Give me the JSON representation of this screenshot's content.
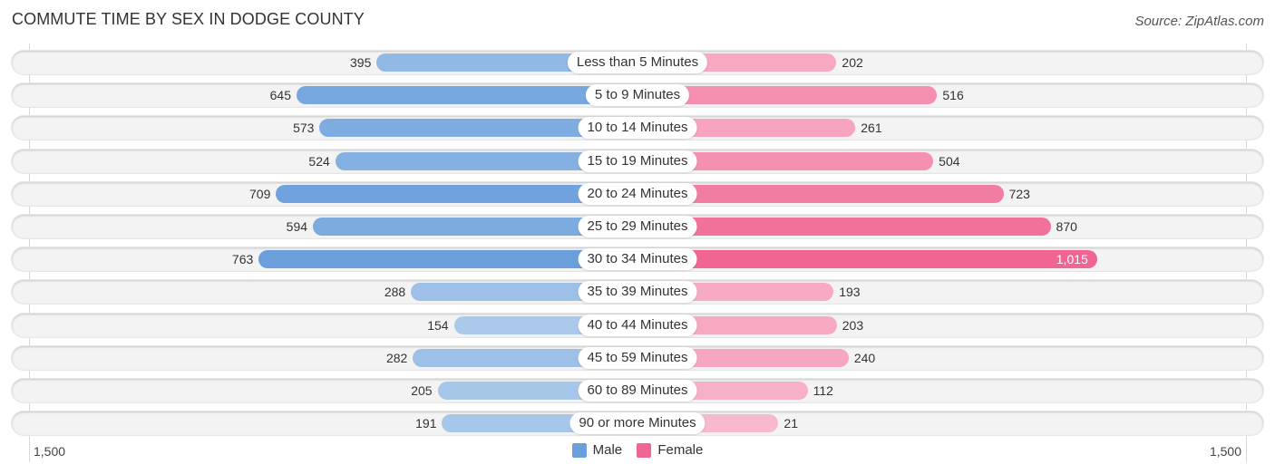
{
  "chart_data": {
    "type": "bar",
    "orientation": "horizontal-diverging",
    "title": "COMMUTE TIME BY SEX IN DODGE COUNTY",
    "source": "Source: ZipAtlas.com",
    "categories": [
      "Less than 5 Minutes",
      "5 to 9 Minutes",
      "10 to 14 Minutes",
      "15 to 19 Minutes",
      "20 to 24 Minutes",
      "25 to 29 Minutes",
      "30 to 34 Minutes",
      "35 to 39 Minutes",
      "40 to 44 Minutes",
      "45 to 59 Minutes",
      "60 to 89 Minutes",
      "90 or more Minutes"
    ],
    "series": [
      {
        "name": "Male",
        "color": "#6a9fdc",
        "values": [
          395,
          645,
          573,
          524,
          709,
          594,
          763,
          288,
          154,
          282,
          205,
          191
        ],
        "labels": [
          "395",
          "645",
          "573",
          "524",
          "709",
          "594",
          "763",
          "288",
          "154",
          "282",
          "205",
          "191"
        ]
      },
      {
        "name": "Female",
        "color": "#f06592",
        "values": [
          202,
          516,
          261,
          504,
          723,
          870,
          1015,
          193,
          203,
          240,
          112,
          21
        ],
        "labels": [
          "202",
          "516",
          "261",
          "504",
          "723",
          "870",
          "1,015",
          "193",
          "203",
          "240",
          "112",
          "21"
        ]
      }
    ],
    "axis": {
      "left_tick": "1,500",
      "right_tick": "1,500",
      "max": 1500
    },
    "legend": {
      "position": "bottom-center",
      "items": [
        "Male",
        "Female"
      ]
    }
  }
}
